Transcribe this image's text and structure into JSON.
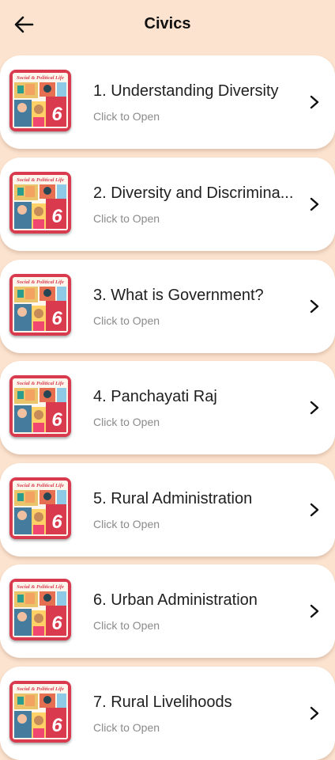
{
  "header": {
    "title": "Civics",
    "back_icon": "arrow-left-icon"
  },
  "thumbnail": {
    "cover_text": "Social & Political Life",
    "cover_number": "6"
  },
  "chapters": [
    {
      "title": "1. Understanding Diversity",
      "subtitle": "Click to Open"
    },
    {
      "title": "2. Diversity and Discrimina...",
      "subtitle": "Click to Open"
    },
    {
      "title": "3. What is Government?",
      "subtitle": "Click to Open"
    },
    {
      "title": "4. Panchayati Raj",
      "subtitle": "Click to Open"
    },
    {
      "title": "5. Rural Administration",
      "subtitle": "Click to Open"
    },
    {
      "title": "6. Urban Administration",
      "subtitle": "Click to Open"
    },
    {
      "title": "7. Rural Livelihoods",
      "subtitle": "Click to Open"
    }
  ],
  "colors": {
    "background": "#fbe3cf",
    "card": "#ffffff",
    "book_red": "#d93a4d"
  }
}
